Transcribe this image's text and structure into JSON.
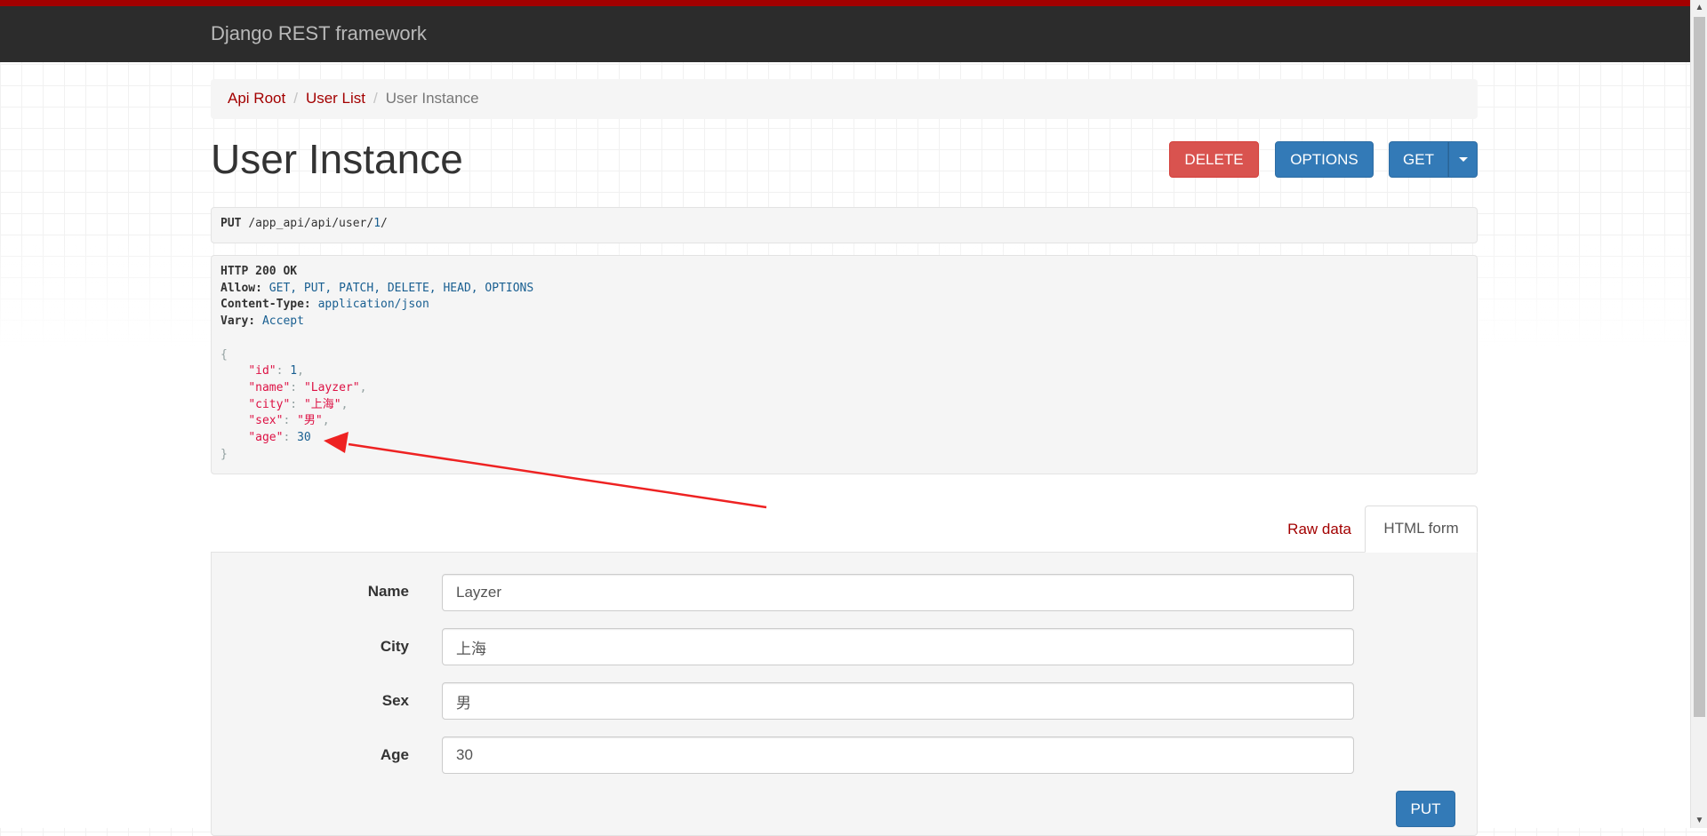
{
  "navbar": {
    "brand": "Django REST framework",
    "accent_color": "#a30000",
    "bg_color": "#2c2c2c"
  },
  "breadcrumb": {
    "items": [
      "Api Root",
      "User List"
    ],
    "active": "User Instance"
  },
  "page": {
    "title": "User Instance",
    "buttons": {
      "delete": "DELETE",
      "options": "OPTIONS",
      "get": "GET"
    }
  },
  "request": {
    "method": "PUT",
    "path": "/app_api/api/user/",
    "path_id": "1",
    "path_end": "/"
  },
  "response": {
    "status": "HTTP 200 OK",
    "headers": [
      {
        "name": "Allow:",
        "value": "GET, PUT, PATCH, DELETE, HEAD, OPTIONS"
      },
      {
        "name": "Content-Type:",
        "value": "application/json"
      },
      {
        "name": "Vary:",
        "value": "Accept"
      }
    ],
    "open_brace": "{",
    "close_brace": "}",
    "body": [
      {
        "key": "\"id\"",
        "value": "1",
        "kind": "num"
      },
      {
        "key": "\"name\"",
        "value": "\"Layzer\"",
        "kind": "str"
      },
      {
        "key": "\"city\"",
        "value": "\"上海\"",
        "kind": "str"
      },
      {
        "key": "\"sex\"",
        "value": "\"男\"",
        "kind": "str"
      },
      {
        "key": "\"age\"",
        "value": "30",
        "kind": "num"
      }
    ]
  },
  "tabs": {
    "raw": "Raw data",
    "html": "HTML form"
  },
  "form": {
    "fields": [
      {
        "label": "Name",
        "value": "Layzer"
      },
      {
        "label": "City",
        "value": "上海"
      },
      {
        "label": "Sex",
        "value": "男"
      },
      {
        "label": "Age",
        "value": "30"
      }
    ],
    "submit": "PUT"
  },
  "annotation": {
    "arrow_color": "#ee2222"
  }
}
